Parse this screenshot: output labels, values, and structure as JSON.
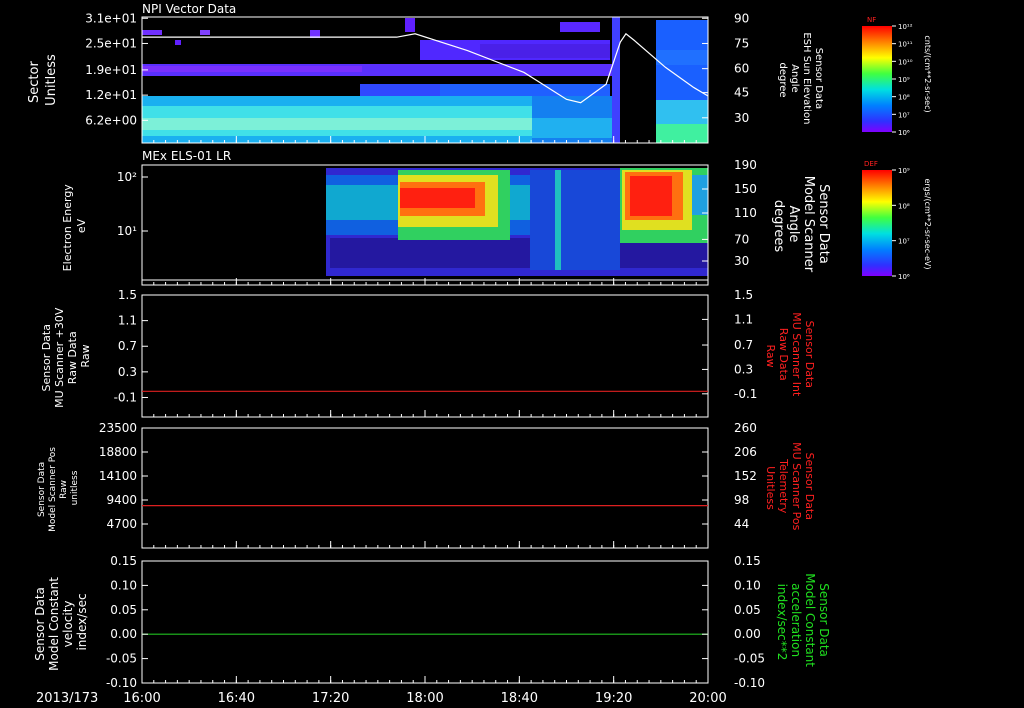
{
  "date_label": "2013/173",
  "x_ticks": [
    "16:00",
    "16:40",
    "17:20",
    "18:00",
    "18:40",
    "19:20",
    "20:00"
  ],
  "chart_data": [
    {
      "type": "heatmap",
      "title": "NPI Vector Data",
      "ylabel": [
        "Sector",
        "Unitless"
      ],
      "y_ticks": [
        "3.1e+01",
        "2.5e+01",
        "1.9e+01",
        "1.2e+01",
        "6.2e+00"
      ],
      "right_ylabel": [
        "Sensor Data",
        "ESH Sun Elevation",
        "Angle",
        "degree"
      ],
      "right_ticks": [
        "90",
        "75",
        "60",
        "45",
        "30"
      ],
      "right_range": [
        15,
        90
      ],
      "overlay_line": {
        "color": "#ffffff",
        "points": [
          [
            16.0,
            78
          ],
          [
            17.8,
            78
          ],
          [
            17.93,
            80
          ],
          [
            18.3,
            70
          ],
          [
            18.7,
            57
          ],
          [
            19.0,
            41
          ],
          [
            19.1,
            39
          ],
          [
            19.28,
            50
          ],
          [
            19.38,
            75
          ],
          [
            19.42,
            80
          ],
          [
            19.48,
            76
          ],
          [
            19.7,
            60
          ],
          [
            19.9,
            48
          ],
          [
            20.0,
            43
          ]
        ]
      },
      "colorbar": {
        "label": "NF",
        "units": "cnts/(cm**2-sr-sec)",
        "ticks": [
          "10¹²",
          "10¹¹",
          "10¹⁰",
          "10⁹",
          "10⁸",
          "10⁷",
          "10⁶"
        ]
      }
    },
    {
      "type": "heatmap",
      "title": "MEx ELS-01 LR",
      "ylabel": [
        "Electron Energy",
        "eV"
      ],
      "y_ticks": [
        "10²",
        "10¹"
      ],
      "right_ylabel": [
        "Sensor Data",
        "Model Scanner",
        "Angle",
        "degrees"
      ],
      "right_ticks": [
        "190",
        "150",
        "110",
        "70",
        "30"
      ],
      "right_range": [
        0,
        190
      ],
      "overlay_line": {
        "color": "#ffffff",
        "points": [
          [
            16.0,
            8
          ],
          [
            20.0,
            8
          ]
        ]
      },
      "colorbar": {
        "label": "DEF",
        "units": "ergs/(cm**2-sr-sec-eV)",
        "ticks": [
          "10⁹",
          "10⁸",
          "10⁷",
          "10⁶"
        ]
      }
    },
    {
      "type": "line",
      "ylabel": [
        "Sensor Data",
        "MU Scanner +30V",
        "Raw Data",
        "Raw"
      ],
      "y_ticks": [
        "1.5",
        "1.1",
        "0.7",
        "0.3",
        "-0.1"
      ],
      "ylim": [
        -0.4,
        1.5
      ],
      "right_ylabel": [
        "Sensor Data",
        "MU Scanner Int",
        "Raw Data",
        "Raw"
      ],
      "right_label_color": "#ff2020",
      "right_ticks": [
        "1.5",
        "1.1",
        "0.7",
        "0.3",
        "-0.1"
      ],
      "series": [
        {
          "color": "#dd2020",
          "x": [
            16.0,
            20.0
          ],
          "y": [
            0.0,
            0.0
          ]
        }
      ]
    },
    {
      "type": "line",
      "ylabel": [
        "Sensor Data",
        "Model Scanner Pos",
        "Raw",
        "unitless"
      ],
      "y_ticks": [
        "23500",
        "18800",
        "14100",
        "9400",
        "4700"
      ],
      "ylim": [
        0,
        23500
      ],
      "right_ylabel": [
        "Sensor Data",
        "MU Scanner Pos",
        "Telemetry",
        "Unitless"
      ],
      "right_label_color": "#ff2020",
      "right_ticks": [
        "260",
        "206",
        "152",
        "98",
        "44"
      ],
      "series": [
        {
          "color": "#dd2020",
          "x": [
            16.0,
            20.0
          ],
          "y": [
            8300,
            8300
          ]
        }
      ]
    },
    {
      "type": "line",
      "ylabel": [
        "Sensor Data",
        "Model Constant",
        "velocity",
        "index/sec"
      ],
      "y_ticks": [
        "0.15",
        "0.10",
        "0.05",
        "0.00",
        "-0.05",
        "-0.10"
      ],
      "ylim": [
        -0.1,
        0.15
      ],
      "right_ylabel": [
        "Sensor Data",
        "Model Constant",
        "acceleration",
        "index/sec**2"
      ],
      "right_label_color": "#20e020",
      "right_ticks": [
        "0.15",
        "0.10",
        "0.05",
        "0.00",
        "-0.05",
        "-0.10"
      ],
      "series": [
        {
          "color": "#20c020",
          "x": [
            16.0,
            20.0
          ],
          "y": [
            0.0,
            0.0
          ]
        }
      ]
    }
  ]
}
